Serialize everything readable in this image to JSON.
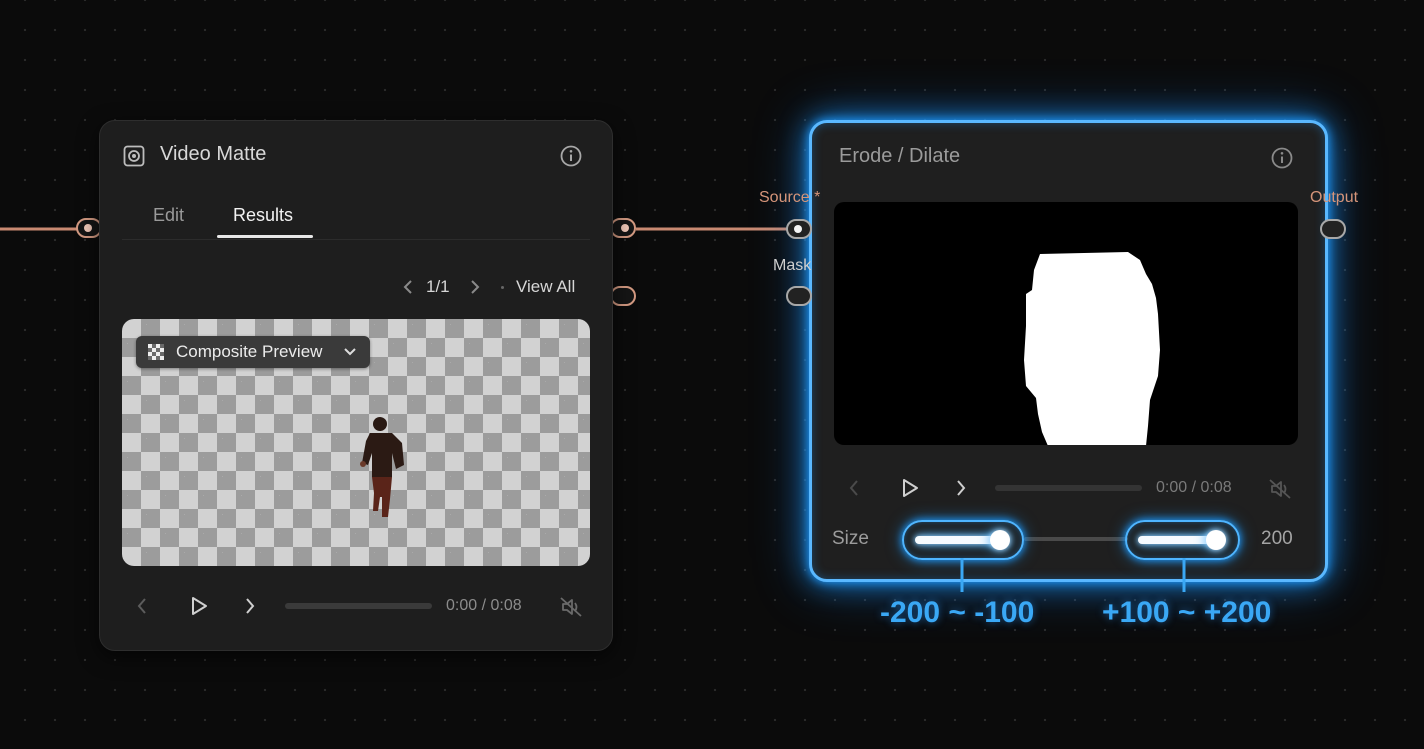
{
  "video_matte": {
    "title": "Video Matte",
    "tabs": [
      {
        "label": "Edit"
      },
      {
        "label": "Results"
      }
    ],
    "active_tab": "Results",
    "pager": {
      "current": "1/1",
      "view_all": "View All"
    },
    "preview_mode": "Composite Preview",
    "time": "0:00 / 0:08"
  },
  "erode_dilate": {
    "title": "Erode / Dilate",
    "ports": {
      "source": "Source *",
      "mask": "Mask",
      "output": "Output"
    },
    "time": "0:00 / 0:08",
    "size": {
      "label": "Size",
      "value": "200"
    }
  },
  "annotations": {
    "negative_range": "-200 ~ -100",
    "positive_range": "+100 ~ +200"
  },
  "colors": {
    "accent_blue": "#3aa8f5",
    "wire": "#d39a82",
    "port_label": "#d6957a"
  },
  "icons": [
    "layers-icon",
    "info-icon",
    "chevron-left-icon",
    "chevron-right-icon",
    "chevron-down-icon",
    "checker-icon",
    "play-icon",
    "mute-icon"
  ]
}
